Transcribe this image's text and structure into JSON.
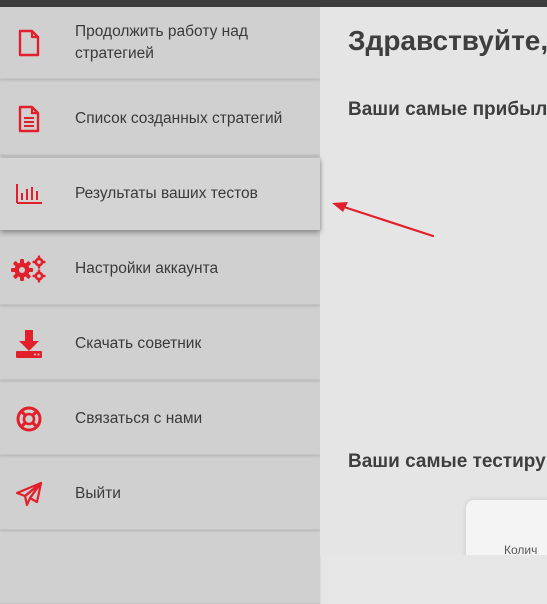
{
  "colors": {
    "accent": "#e2202b",
    "sidebar_bg": "#d0d0d0",
    "main_bg": "#e5e5e5",
    "topbar": "#3d3d3d",
    "text": "#3a3a3a"
  },
  "sidebar": {
    "items": [
      {
        "label": "Продолжить работу над стратегией",
        "icon": "file-icon"
      },
      {
        "label": "Список созданных стратегий",
        "icon": "file-text-icon"
      },
      {
        "label": "Результаты ваших тестов",
        "icon": "bar-chart-icon",
        "active": true
      },
      {
        "label": "Настройки аккаунта",
        "icon": "gears-icon"
      },
      {
        "label": "Скачать советник",
        "icon": "download-icon"
      },
      {
        "label": "Связаться с нами",
        "icon": "lifebuoy-icon"
      },
      {
        "label": "Выйти",
        "icon": "paper-plane-icon"
      }
    ]
  },
  "main": {
    "greeting": "Здравствуйте,",
    "section_profitable": "Ваши самые прибыль",
    "section_tested": "Ваши самые тестиру",
    "card_label": "Колич"
  },
  "annotation": {
    "arrow_color": "#e2202b"
  }
}
